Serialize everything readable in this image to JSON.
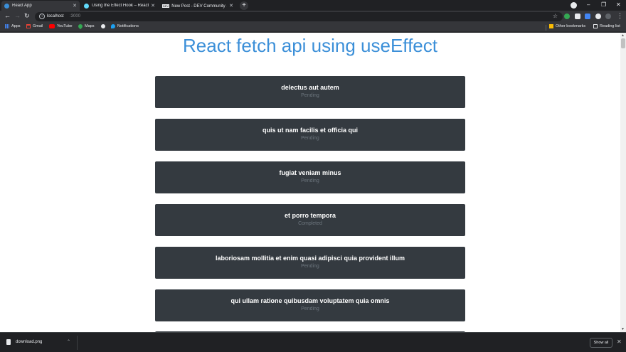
{
  "browser": {
    "tabs": [
      {
        "title": "React App",
        "favicon_color": "#3b8fd8",
        "active": true
      },
      {
        "title": "Using the Effect Hook – React",
        "favicon_color": "#61dafb",
        "active": false
      },
      {
        "title": "New Post - DEV Community 👋 🔔",
        "favicon_label": "DEV",
        "active": false
      }
    ],
    "new_tab_label": "+",
    "window_controls": {
      "minimize": "–",
      "restore": "❐",
      "close": "✕"
    },
    "url_host": "localhost",
    "url_port": ":3000",
    "bookmarks": [
      {
        "label": "Apps",
        "icon": "apps-grid-icon",
        "color": "#4285f4"
      },
      {
        "label": "Gmail",
        "icon": "gmail-icon",
        "color": "#ea4335"
      },
      {
        "label": "YouTube",
        "icon": "youtube-icon",
        "color": "#ff0000"
      },
      {
        "label": "Maps",
        "icon": "maps-pin-icon",
        "color": "#34a853"
      },
      {
        "label": "",
        "icon": "globe-icon",
        "color": "#e8eaed"
      },
      {
        "label": "Notifications",
        "icon": "twitter-icon",
        "color": "#1da1f2"
      }
    ],
    "other_bookmarks": "Other bookmarks",
    "reading_list": "Reading list"
  },
  "page": {
    "title": "React fetch api using useEffect",
    "todos": [
      {
        "title": "delectus aut autem",
        "status": "Pending"
      },
      {
        "title": "quis ut nam facilis et officia qui",
        "status": "Pending"
      },
      {
        "title": "fugiat veniam minus",
        "status": "Pending"
      },
      {
        "title": "et porro tempora",
        "status": "Completed"
      },
      {
        "title": "laboriosam mollitia et enim quasi adipisci quia provident illum",
        "status": "Pending"
      },
      {
        "title": "qui ullam ratione quibusdam voluptatem quia omnis",
        "status": "Pending"
      }
    ]
  },
  "downloads": {
    "file_name": "download.png",
    "show_all": "Show all"
  }
}
